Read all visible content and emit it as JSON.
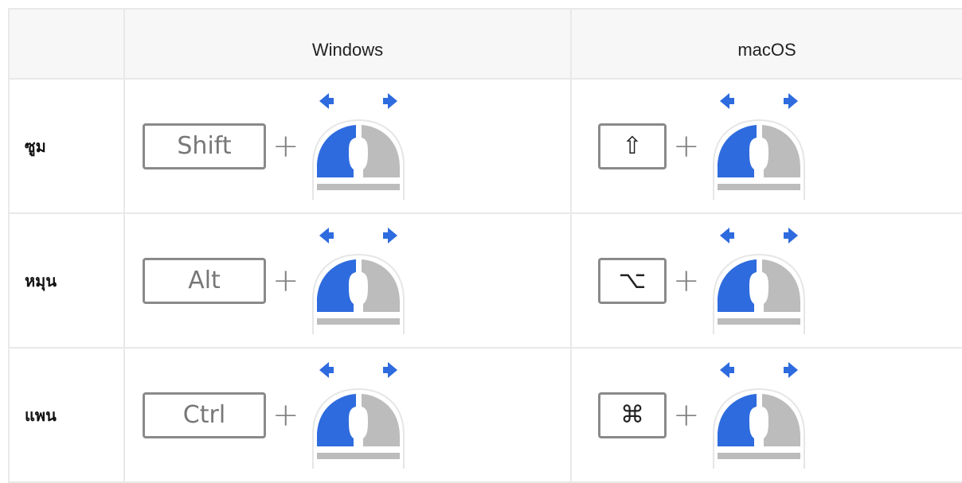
{
  "table": {
    "headers": [
      "",
      "Windows",
      "macOS"
    ],
    "rows": [
      {
        "label": "ซูม",
        "windows_key": "Shift",
        "mac_key": "⇧",
        "mac_key_icon": "shift-icon"
      },
      {
        "label": "หมุน",
        "windows_key": "Alt",
        "mac_key": "⌥",
        "mac_key_icon": "option-icon"
      },
      {
        "label": "แพน",
        "windows_key": "Ctrl",
        "mac_key": "⌘",
        "mac_key_icon": "command-icon"
      }
    ],
    "plus_sign": "+",
    "mouse_icon": "mouse-left-drag-icon"
  },
  "colors": {
    "accent_blue": "#2e6bde",
    "mouse_gray": "#bcbcbc",
    "border": "#e9e9e9",
    "header_bg": "#f7f7f7",
    "key_border": "#8a8a8a"
  }
}
